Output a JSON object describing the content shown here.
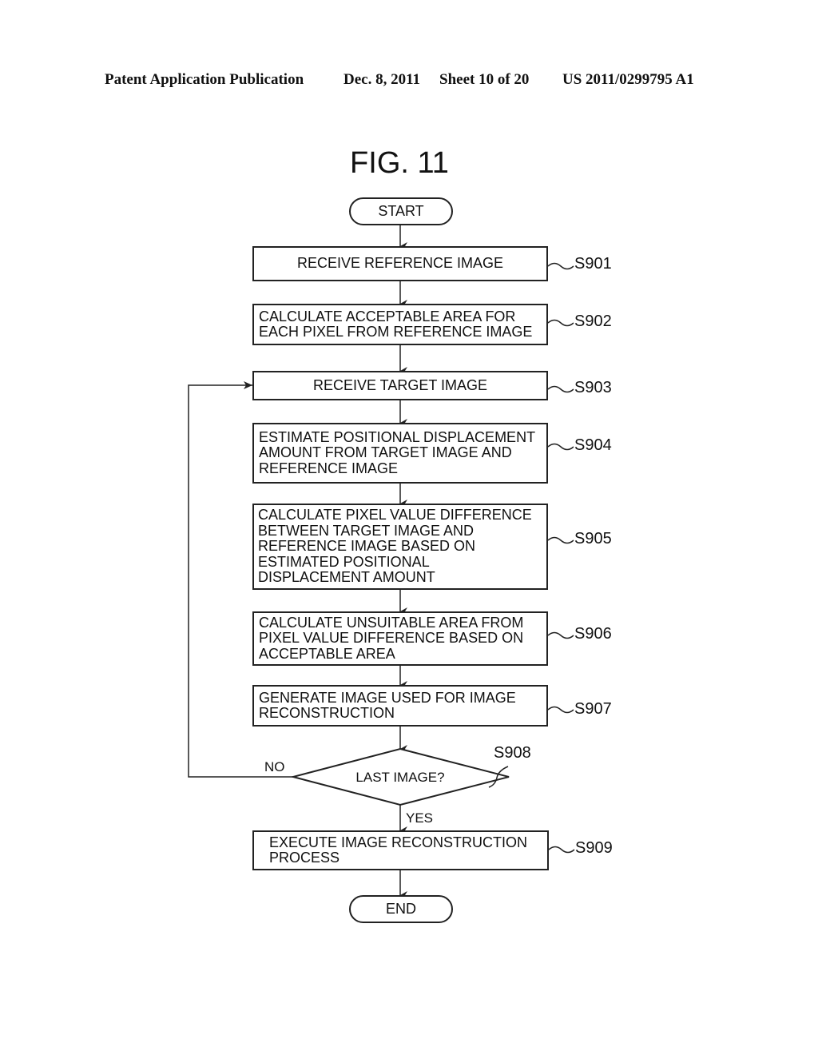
{
  "header": {
    "publication": "Patent Application Publication",
    "date": "Dec. 8, 2011",
    "sheet": "Sheet 10 of 20",
    "number": "US 2011/0299795 A1"
  },
  "figure_title": "FIG. 11",
  "flowchart": {
    "start": "START",
    "end": "END",
    "steps": [
      {
        "id": "S901",
        "text": "RECEIVE REFERENCE IMAGE"
      },
      {
        "id": "S902",
        "text": "CALCULATE ACCEPTABLE AREA FOR\nEACH PIXEL FROM REFERENCE IMAGE"
      },
      {
        "id": "S903",
        "text": "RECEIVE TARGET IMAGE"
      },
      {
        "id": "S904",
        "text": "ESTIMATE POSITIONAL DISPLACEMENT\nAMOUNT FROM TARGET IMAGE AND\nREFERENCE IMAGE"
      },
      {
        "id": "S905",
        "text": "CALCULATE PIXEL VALUE DIFFERENCE\nBETWEEN TARGET IMAGE AND\nREFERENCE IMAGE BASED ON\nESTIMATED POSITIONAL\nDISPLACEMENT AMOUNT"
      },
      {
        "id": "S906",
        "text": "CALCULATE UNSUITABLE AREA FROM\nPIXEL VALUE DIFFERENCE BASED ON\nACCEPTABLE AREA"
      },
      {
        "id": "S907",
        "text": "GENERATE IMAGE USED FOR IMAGE\nRECONSTRUCTION"
      },
      {
        "id": "S909",
        "text": "EXECUTE IMAGE RECONSTRUCTION\nPROCESS"
      }
    ],
    "decision": {
      "id": "S908",
      "text": "LAST IMAGE?",
      "no_label": "NO",
      "yes_label": "YES"
    }
  }
}
